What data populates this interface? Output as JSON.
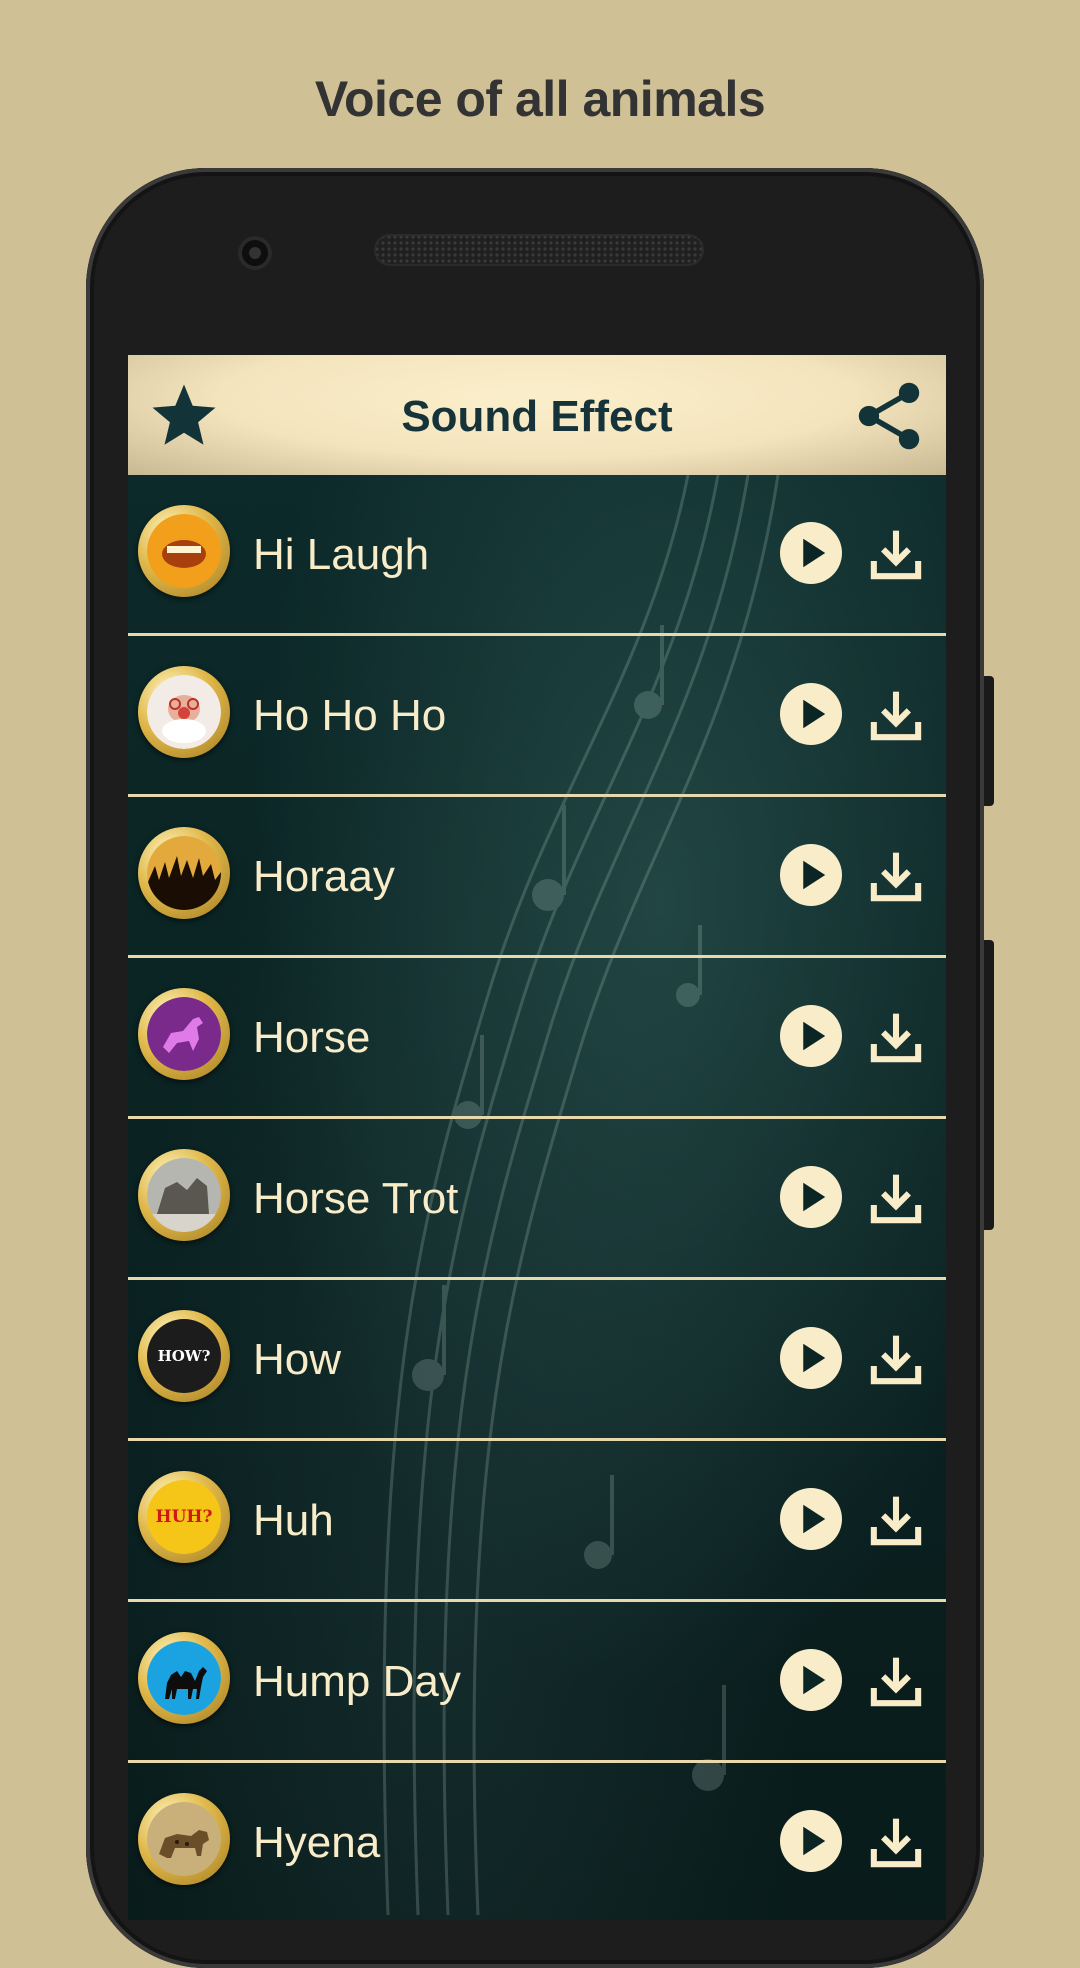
{
  "promo": {
    "title": "Voice of all animals"
  },
  "header": {
    "title": "Sound Effect",
    "left_icon": "star-icon",
    "right_icon": "share-icon"
  },
  "colors": {
    "background": "#d0c096",
    "header": "#f3e4bd",
    "accent": "#f8ecc9",
    "list_bg": "#0b2424"
  },
  "sounds": [
    {
      "label": "Hi Laugh",
      "icon": "laughing-mouth-icon",
      "color": "#f2a01c"
    },
    {
      "label": "Ho Ho Ho",
      "icon": "santa-face-icon",
      "color": "#e8d6cc"
    },
    {
      "label": "Horaay",
      "icon": "crowd-cheering-icon",
      "color": "#c58a2a"
    },
    {
      "label": "Horse",
      "icon": "horse-icon",
      "color": "#7a2a8a"
    },
    {
      "label": "Horse Trot",
      "icon": "horse-photo-icon",
      "color": "#8a8a86"
    },
    {
      "label": "How",
      "icon": "how-question-icon",
      "color": "#1c1c1c",
      "badge": "HOW?"
    },
    {
      "label": "Huh",
      "icon": "huh-question-icon",
      "color": "#f5c518",
      "badge": "HUH?"
    },
    {
      "label": "Hump Day",
      "icon": "camel-icon",
      "color": "#1aa3e0"
    },
    {
      "label": "Hyena",
      "icon": "hyena-icon",
      "color": "#9a7a4a"
    }
  ]
}
